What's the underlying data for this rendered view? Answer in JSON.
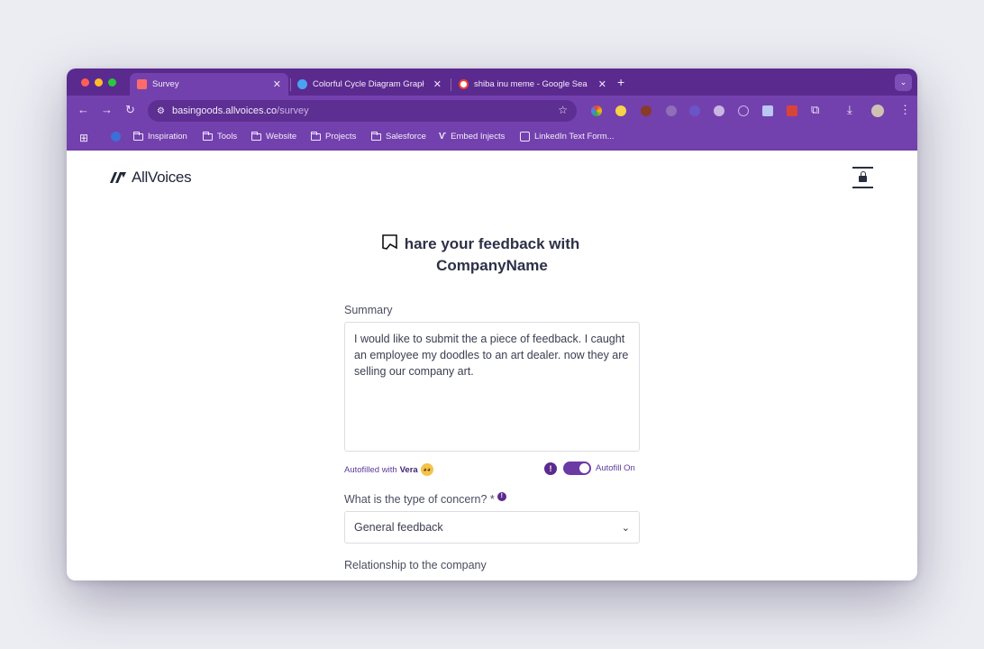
{
  "browser": {
    "tabs": [
      {
        "title": "Survey",
        "favicon_color": "#ff6b6b",
        "active": true
      },
      {
        "title": "Colorful Cycle Diagram Grapł",
        "favicon_color": "#4aa3f0",
        "active": false
      },
      {
        "title": "shiba inu meme - Google Sea",
        "favicon_color": "#ffffff",
        "active": false
      }
    ],
    "url_host": "basingoods.allvoices.co",
    "url_path": "/survey",
    "bookmarks": [
      {
        "label": "Inspiration",
        "icon": "folder-icon"
      },
      {
        "label": "Tools",
        "icon": "folder-icon"
      },
      {
        "label": "Website",
        "icon": "folder-icon"
      },
      {
        "label": "Projects",
        "icon": "folder-icon"
      },
      {
        "label": "Salesforce",
        "icon": "folder-icon"
      },
      {
        "label": "Embed Injects",
        "icon": "allvoices-icon"
      },
      {
        "label": "LinkedIn Text Form...",
        "icon": "linkedin-icon"
      }
    ],
    "colors": {
      "tab_strip": "#5b2a8f",
      "toolbar": "#7341ad"
    }
  },
  "app": {
    "logo_text": "AllVoices",
    "title_line1": "hare your feedback with",
    "title_line2": "CompanyName"
  },
  "form": {
    "summary_label": "Summary",
    "summary_value": "I would like to submit the a piece of feedback. I caught an employee my doodles to an art dealer. now they are selling our company art.",
    "autofilled_prefix": "Autofilled with",
    "autofilled_name": "Vera",
    "autofill_toggle_label": "Autofill On",
    "autofill_on": true,
    "concern_label": "What is the type of concern? *",
    "concern_value": "General feedback",
    "relationship_label": "Relationship to the company"
  }
}
